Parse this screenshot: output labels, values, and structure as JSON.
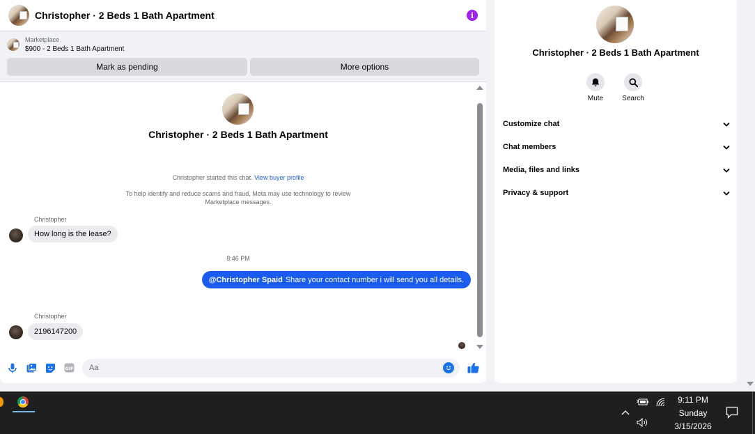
{
  "chat": {
    "title": "Christopher · 2 Beds 1 Bath Apartment",
    "info_icon": "info-icon",
    "marketplace": {
      "label": "Marketplace",
      "listing": "$900 - 2 Beds 1 Bath Apartment",
      "mark_pending_label": "Mark as pending",
      "more_options_label": "More options"
    },
    "intro_name": "Christopher · 2 Beds 1 Bath Apartment",
    "started_text": "Christopher started this chat.",
    "view_profile_label": "View buyer profile",
    "notice": "To help identify and reduce scams and fraud, Meta may use technology to review Marketplace messages.",
    "messages": [
      {
        "sender": "Christopher",
        "text": "How long is the lease?"
      },
      {
        "timestamp": "8:46 PM"
      },
      {
        "mention": "@Christopher Spaid",
        "text": "Share your contact number i will send you all details."
      },
      {
        "sender": "Christopher",
        "text": "2196147200"
      }
    ],
    "composer": {
      "placeholder": "Aa",
      "icons": [
        "microphone-icon",
        "photo-icon",
        "sticker-icon",
        "gif-icon",
        "emoji-icon",
        "thumbs-up-icon"
      ]
    }
  },
  "info_panel": {
    "name": "Christopher · 2 Beds 1 Bath Apartment",
    "actions": [
      {
        "label": "Mute",
        "icon": "bell-icon"
      },
      {
        "label": "Search",
        "icon": "search-icon"
      }
    ],
    "sections": [
      {
        "label": "Customize chat"
      },
      {
        "label": "Chat members"
      },
      {
        "label": "Media, files and links"
      },
      {
        "label": "Privacy & support"
      }
    ]
  },
  "taskbar": {
    "time": "9:11 PM",
    "day": "Sunday",
    "date": "3/15/2026",
    "apps": [
      "app-icon",
      "chrome-icon"
    ],
    "tray_icons": [
      "chevron-up-icon",
      "battery-icon",
      "wifi-icon",
      "speaker-icon",
      "notification-icon"
    ]
  },
  "colors": {
    "outgoing_bubble": "#1a5cf0",
    "link": "#1b5fd1",
    "info_icon": "#a020f0"
  }
}
